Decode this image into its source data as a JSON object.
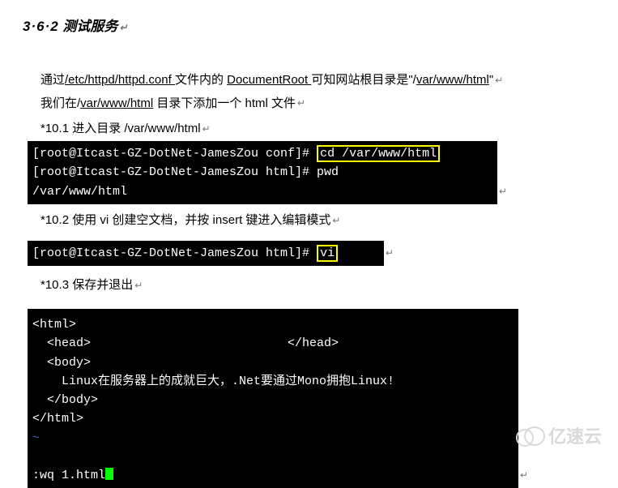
{
  "heading": {
    "number": "3·6·2",
    "title_cn": " 测试服务",
    "marker": "↵"
  },
  "para": {
    "line1_pre": "通过",
    "line1_link1": "/etc/httpd/httpd.conf ",
    "line1_mid": "文件内的 ",
    "line1_link2": "DocumentRoot ",
    "line1_post": "可知网站根目录是\"/",
    "line1_var": "var/www/html",
    "line1_end": "\"",
    "line1_marker": "↵",
    "line2_pre": "我们在/",
    "line2_var": "var/www/html",
    "line2_post": " 目录下添加一个 html 文件",
    "line2_marker": "↵"
  },
  "step101": {
    "label": "*10.1",
    "text": "  进入目录  /var/www/html",
    "marker": "↵"
  },
  "terminal1": {
    "line1_prompt": "[root@Itcast-GZ-DotNet-JamesZou conf]# ",
    "line1_cmd": "cd /var/www/html",
    "line2": "[root@Itcast-GZ-DotNet-JamesZou html]# pwd",
    "line3": "/var/www/html",
    "trailing_marker": "↵"
  },
  "step102": {
    "label": "*10.2",
    "text": "  使用  vi  创建空文档，并按  insert 键进入编辑模式",
    "marker": "↵"
  },
  "terminal2": {
    "line1_prompt": "[root@Itcast-GZ-DotNet-JamesZou html]# ",
    "line1_cmd": "vi",
    "trailing_marker": "↵"
  },
  "step103": {
    "label": "*10.3",
    "text": "  保存并退出",
    "marker": "↵"
  },
  "terminal3": {
    "l1": "<html>",
    "l2": "  <head>                           </head>",
    "l3": "  <body>",
    "l4": "    Linux在服务器上的成就巨大，.Net要通过Mono拥抱Linux!",
    "l5": "  </body>",
    "l6": "</html>",
    "tilde": "~",
    "cmd": ":wq 1.html",
    "trailing_marker": "↵"
  },
  "watermark": "亿速云"
}
